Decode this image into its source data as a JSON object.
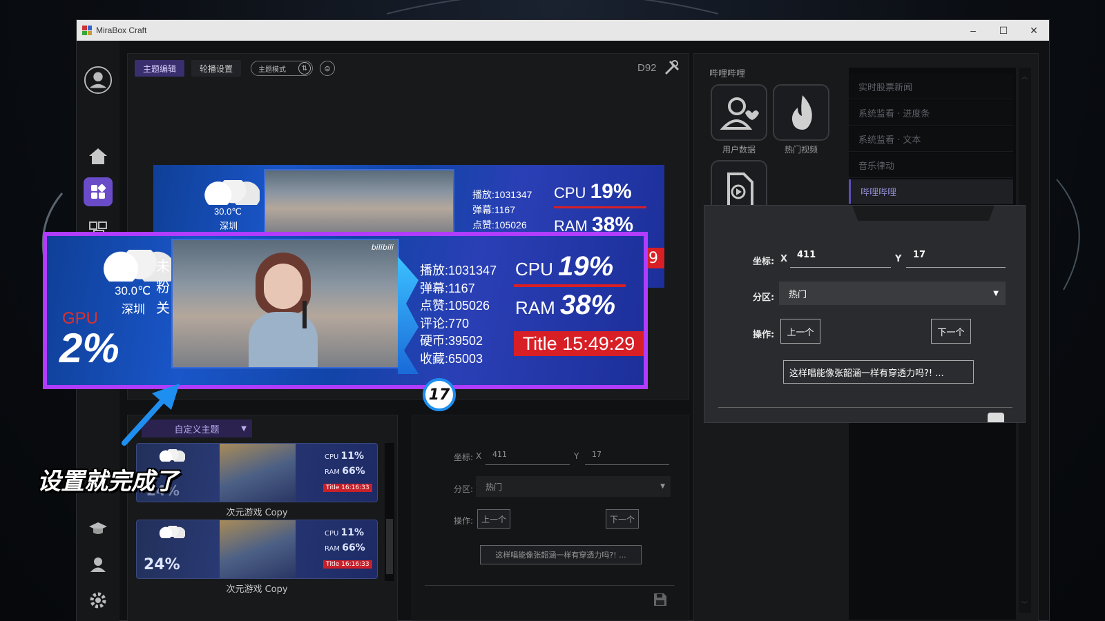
{
  "window": {
    "title": "MiraBox Craft",
    "controls": {
      "minimize": "–",
      "maximize": "☐",
      "close": "✕"
    }
  },
  "toolbar": {
    "tab_theme_edit": "主题编辑",
    "tab_carousel": "轮播设置",
    "theme_mode_label": "主题模式",
    "device_name": "D92"
  },
  "banner": {
    "temperature": "30.0℃",
    "city": "深圳",
    "side_chars": [
      "未",
      "粉",
      "关"
    ],
    "gpu_label": "GPU",
    "gpu_value": "2%",
    "stats": [
      "播放:1031347",
      "弹幕:1167",
      "点赞:105026",
      "评论:770",
      "硬币:39502",
      "收藏:65003"
    ],
    "cpu_label": "CPU",
    "cpu_value": "19%",
    "ram_label": "RAM",
    "ram_value": "38%",
    "title_clock": "Title 15:49:29",
    "watermark": "bilibili",
    "step_number": "17",
    "small_stats": [
      "播放:1031347",
      "弹幕:1167",
      "点赞:105026"
    ],
    "small_partial_digit": "9"
  },
  "caption": "设置就完成了",
  "theme_list": {
    "dropdown_label": "自定义主题",
    "items": [
      {
        "name": "次元游戏 Copy",
        "cpu": "11%",
        "ram": "66%",
        "clock": "Title 16:16:33",
        "gpu": "24%"
      },
      {
        "name": "次元游戏 Copy",
        "cpu": "11%",
        "ram": "66%",
        "clock": "Title 16:16:33",
        "gpu": "24%"
      }
    ]
  },
  "lower_settings": {
    "coord_label": "坐标:",
    "x_label": "X",
    "x_value": "411",
    "y_label": "Y",
    "y_value": "17",
    "partition_label": "分区:",
    "partition_value": "热门",
    "action_label": "操作:",
    "prev_button": "上一个",
    "next_button": "下一个",
    "video_title_button": "这样唱能像张韶涵一样有穿透力吗?! ..."
  },
  "right_panel": {
    "section_title": "哔哩哔哩",
    "tiles": [
      {
        "label": "用户数据",
        "icon": "user-heart-icon"
      },
      {
        "label": "热门视频",
        "icon": "flame-icon"
      },
      {
        "label": "",
        "icon": "video-file-icon"
      }
    ],
    "plugin_list": [
      {
        "label": "实时股票新闻",
        "active": false
      },
      {
        "label": "系统监看 · 进度条",
        "active": false
      },
      {
        "label": "系统监看 · 文本",
        "active": false
      },
      {
        "label": "音乐律动",
        "active": false
      },
      {
        "label": "哔哩哔哩",
        "active": true
      }
    ]
  },
  "popup_settings": {
    "coord_label": "坐标:",
    "x_label": "X",
    "x_value": "411",
    "y_label": "Y",
    "y_value": "17",
    "partition_label": "分区:",
    "partition_value": "热门",
    "action_label": "操作:",
    "prev_button": "上一个",
    "next_button": "下一个",
    "video_title_button": "这样唱能像张韶涵一样有穿透力吗?! ..."
  },
  "colors": {
    "accent_purple": "#b03cff",
    "title_red": "#d81f26",
    "gpu_red": "#e0302a",
    "arrow_blue": "#1e8ff0",
    "app_bg": "#101113"
  }
}
